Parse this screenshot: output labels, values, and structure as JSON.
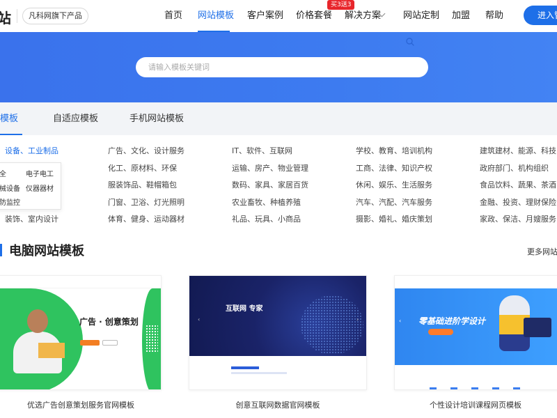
{
  "header": {
    "logo_char": "站",
    "brand_badge": "凡科网旗下产品",
    "nav": [
      {
        "label": "首页"
      },
      {
        "label": "网站模板",
        "active": true
      },
      {
        "label": "客户案例"
      },
      {
        "label": "价格套餐",
        "badge": "买3送3"
      },
      {
        "label": "解决方案"
      },
      {
        "label": "网站定制"
      },
      {
        "label": "加盟"
      },
      {
        "label": "帮助"
      }
    ],
    "enter_button": "进入管",
    "accent_color": "#1e6fe8",
    "promo_color": "#e8262b"
  },
  "hero": {
    "search_placeholder": "请输入模板关键词",
    "background_color": "#3a72ec"
  },
  "tabs": [
    {
      "label": "模板",
      "active": true
    },
    {
      "label": "自适应模板"
    },
    {
      "label": "手机网站模板"
    }
  ],
  "categories": {
    "columns": [
      [
        "设备、工业制品",
        "",
        "",
        "装饰、室内设计"
      ],
      [
        "广告、文化、设计服务",
        "化工、原材料、环保",
        "服装饰品、鞋帽箱包",
        "门窗、卫浴、灯光照明",
        "体育、健身、运动器材"
      ],
      [
        "IT、软件、互联网",
        "运输、房产、物业管理",
        "数码、家具、家居百货",
        "农业畜牧、种植养殖",
        "礼品、玩具、小商品"
      ],
      [
        "学校、教育、培训机构",
        "工商、法律、知识产权",
        "休闲、娱乐、生活服务",
        "汽车、汽配、汽车服务",
        "摄影、婚礼、婚庆策划"
      ],
      [
        "建筑建材、能源、科技",
        "政府部门、机构组织",
        "食品饮料、蔬果、茶酒",
        "金融、投资、理财保险",
        "家政、保洁、月嫂服务"
      ]
    ],
    "dropdown": [
      "全",
      "电子电工",
      "械设备",
      "仪器器材",
      "防监控"
    ]
  },
  "section": {
    "title": "电脑网站模板",
    "more": "更多网站"
  },
  "cards": [
    {
      "caption": "优选广告创意策划服务官网模板",
      "preview_title": "广告 · 创意策划"
    },
    {
      "caption": "创意互联网数据官网模板",
      "preview_title": "互联网 专家"
    },
    {
      "caption": "个性设计培训课程网页模板",
      "preview_title": "零基础进阶学设计"
    }
  ]
}
